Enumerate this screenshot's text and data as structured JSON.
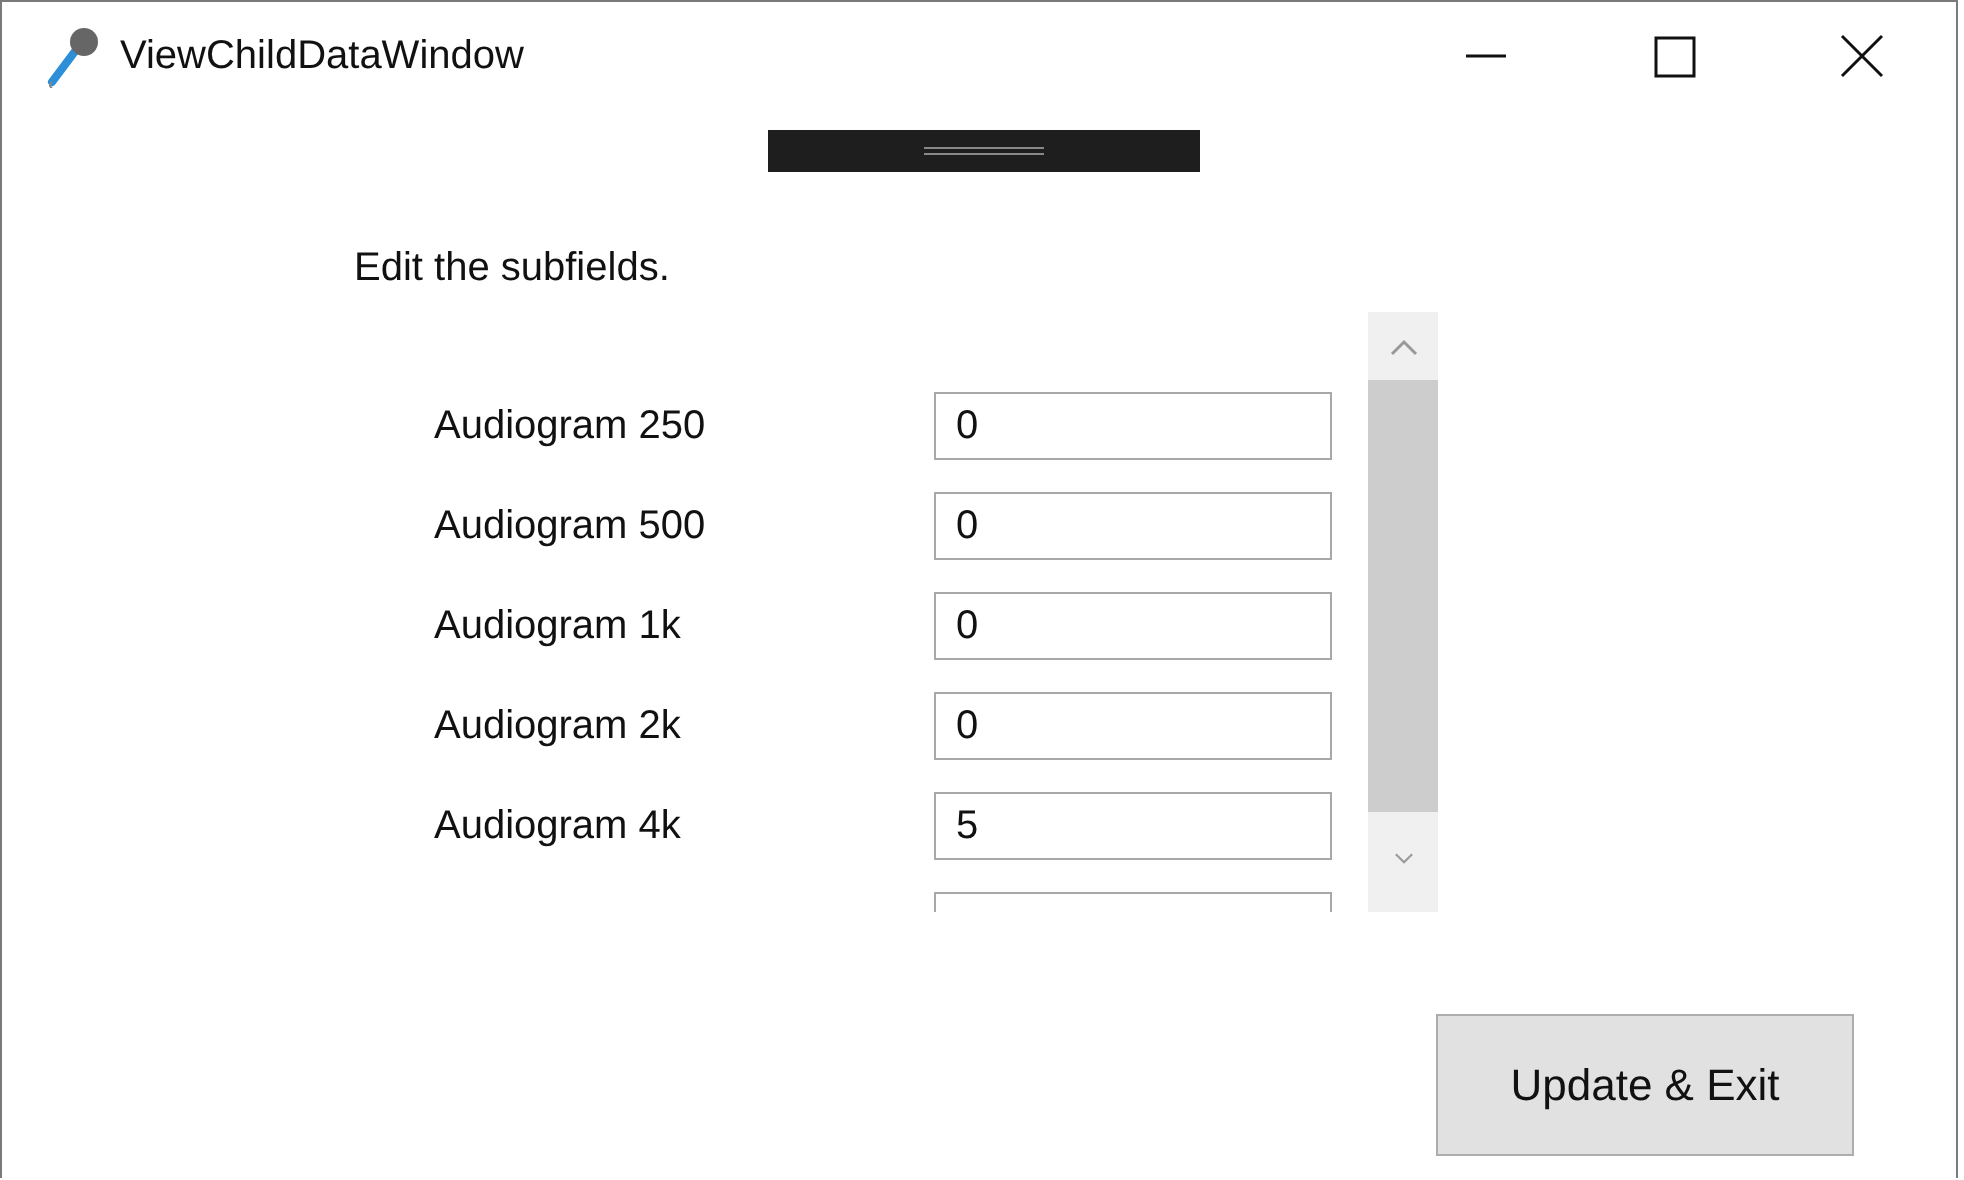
{
  "window": {
    "title": "ViewChildDataWindow"
  },
  "instruction": "Edit the subfields.",
  "rows": [
    {
      "kind": "field",
      "label": "Audiogram 250",
      "value": "0"
    },
    {
      "kind": "field",
      "label": "Audiogram 500",
      "value": "0"
    },
    {
      "kind": "field",
      "label": "Audiogram 1k",
      "value": "0"
    },
    {
      "kind": "field",
      "label": "Audiogram 2k",
      "value": "0"
    },
    {
      "kind": "field",
      "label": "Audiogram 4k",
      "value": "5"
    },
    {
      "kind": "cut"
    }
  ],
  "buttons": [
    "Update & Exit"
  ]
}
